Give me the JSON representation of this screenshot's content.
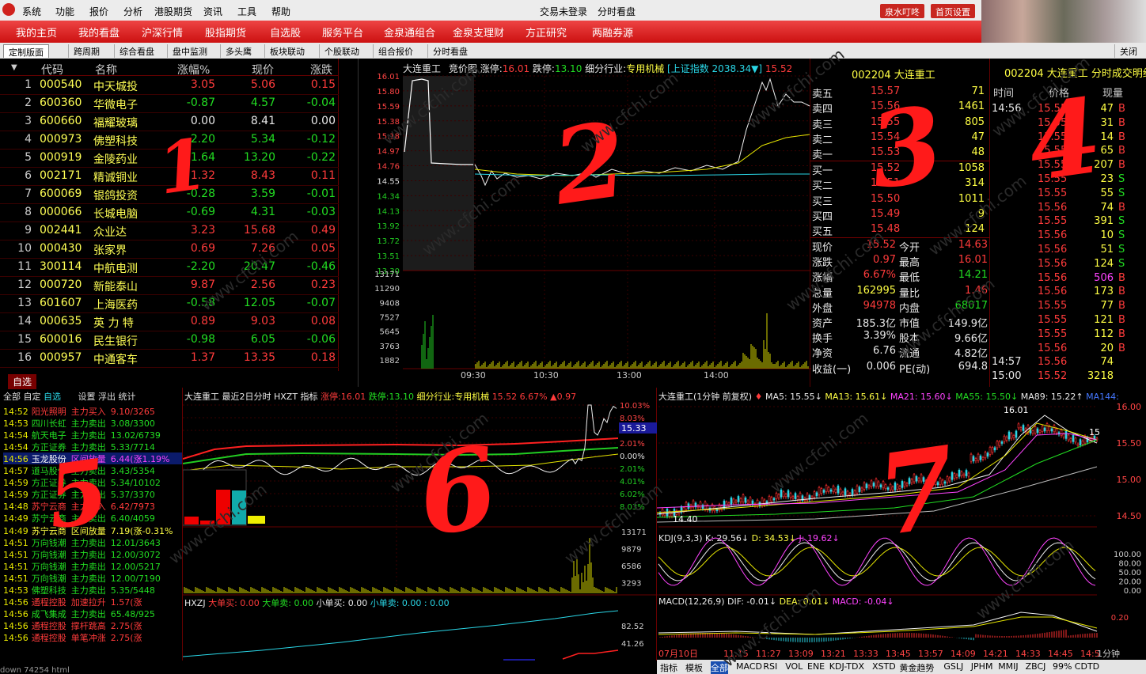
{
  "menu": {
    "items": [
      "系统",
      "功能",
      "报价",
      "分析",
      "港股期货",
      "资讯",
      "工具",
      "帮助"
    ],
    "center1": "交易未登录",
    "center2": "分时看盘",
    "btn1": "泉水叮咚",
    "btn2": "首页设置"
  },
  "nav": {
    "items": [
      "我的主页",
      "我的看盘",
      "沪深行情",
      "股指期货",
      "自选股",
      "服务平台",
      "金泉通组合",
      "金泉支理财",
      "方正研究",
      "两融券源"
    ]
  },
  "tabs": {
    "items": [
      "定制版面",
      "跨周期",
      "综合看盘",
      "盘中监测",
      "多头鹰",
      "板块联动",
      "个股联动",
      "组合报价",
      "分时看盘"
    ],
    "close": "关闭"
  },
  "list": {
    "headers": [
      "代码",
      "名称",
      "涨幅%",
      "现价",
      "涨跌"
    ],
    "rows": [
      {
        "i": "1",
        "code": "000540",
        "name": "中天城投",
        "pct": "3.05",
        "price": "5.06",
        "chg": "0.15",
        "c": "r"
      },
      {
        "i": "2",
        "code": "600360",
        "name": "华微电子",
        "pct": "-0.87",
        "price": "4.57",
        "chg": "-0.04",
        "c": "g"
      },
      {
        "i": "3",
        "code": "600660",
        "name": "福耀玻璃",
        "pct": "0.00",
        "price": "8.41",
        "chg": "0.00",
        "c": "w"
      },
      {
        "i": "4",
        "code": "000973",
        "name": "佛塑科技",
        "pct": "-2.20",
        "price": "5.34",
        "chg": "-0.12",
        "c": "g"
      },
      {
        "i": "5",
        "code": "000919",
        "name": "金陵药业",
        "pct": "-1.64",
        "price": "13.20",
        "chg": "-0.22",
        "c": "g"
      },
      {
        "i": "6",
        "code": "002171",
        "name": "精诚铜业",
        "pct": "1.32",
        "price": "8.43",
        "chg": "0.11",
        "c": "r"
      },
      {
        "i": "7",
        "code": "600069",
        "name": "银鸽投资",
        "pct": "-0.28",
        "price": "3.59",
        "chg": "-0.01",
        "c": "g"
      },
      {
        "i": "8",
        "code": "000066",
        "name": "长城电脑",
        "pct": "-0.69",
        "price": "4.31",
        "chg": "-0.03",
        "c": "g"
      },
      {
        "i": "9",
        "code": "002441",
        "name": "众业达",
        "pct": "3.23",
        "price": "15.68",
        "chg": "0.49",
        "c": "r"
      },
      {
        "i": "10",
        "code": "000430",
        "name": "张家界",
        "pct": "0.69",
        "price": "7.26",
        "chg": "0.05",
        "c": "r"
      },
      {
        "i": "11",
        "code": "300114",
        "name": "中航电测",
        "pct": "-2.20",
        "price": "20.47",
        "chg": "-0.46",
        "c": "g"
      },
      {
        "i": "12",
        "code": "000720",
        "name": "新能泰山",
        "pct": "9.87",
        "price": "2.56",
        "chg": "0.23",
        "c": "r"
      },
      {
        "i": "13",
        "code": "601607",
        "name": "上海医药",
        "pct": "-0.58",
        "price": "12.05",
        "chg": "-0.07",
        "c": "g"
      },
      {
        "i": "14",
        "code": "000635",
        "name": "英 力 特",
        "pct": "0.89",
        "price": "9.03",
        "chg": "0.08",
        "c": "r"
      },
      {
        "i": "15",
        "code": "600016",
        "name": "民生银行",
        "pct": "-0.98",
        "price": "6.05",
        "chg": "-0.06",
        "c": "g"
      },
      {
        "i": "16",
        "code": "000957",
        "name": "中通客车",
        "pct": "1.37",
        "price": "13.35",
        "chg": "0.18",
        "c": "r"
      }
    ],
    "zixuan": "自选"
  },
  "intraday": {
    "title": "大连重工",
    "sub": "竞价图",
    "zt_label": "涨停:",
    "zt": "16.01",
    "dt_label": "跌停:",
    "dt": "13.10",
    "ind_label": "细分行业:",
    "industry": "专用机械",
    "index": "[上证指数 2038.34▼]",
    "last": "15.52",
    "yticks": [
      "16.01",
      "15.80",
      "15.59",
      "15.38",
      "15.18",
      "14.97",
      "14.76",
      "14.55",
      "14.34",
      "14.13",
      "13.92",
      "13.72",
      "13.51",
      "13.30"
    ],
    "vticks": [
      "13171",
      "11290",
      "9408",
      "7527",
      "5645",
      "3763",
      "1882"
    ],
    "xticks": [
      "09:30",
      "10:30",
      "13:00",
      "14:00"
    ]
  },
  "quote": {
    "title": "002204 大连重工",
    "asks": [
      [
        "卖五",
        "15.57",
        "71"
      ],
      [
        "卖四",
        "15.56",
        "1461"
      ],
      [
        "卖三",
        "15.55",
        "805"
      ],
      [
        "卖二",
        "15.54",
        "47"
      ],
      [
        "卖一",
        "15.53",
        "48"
      ]
    ],
    "bids": [
      [
        "买一",
        "15.52",
        "1058"
      ],
      [
        "买二",
        "15.51",
        "314"
      ],
      [
        "买三",
        "15.50",
        "1011"
      ],
      [
        "买四",
        "15.49",
        "9"
      ],
      [
        "买五",
        "15.48",
        "124"
      ]
    ],
    "stats": [
      [
        "现价",
        "15.52",
        "今开",
        "14.63"
      ],
      [
        "涨跌",
        "0.97",
        "最高",
        "16.01"
      ],
      [
        "涨幅",
        "6.67%",
        "最低",
        "14.21"
      ],
      [
        "总量",
        "162995",
        "量比",
        "1.46"
      ],
      [
        "外盘",
        "94978",
        "内盘",
        "68017"
      ],
      [
        "资产",
        "185.3亿",
        "市值",
        "149.9亿"
      ],
      [
        "换手",
        "3.39%",
        "股本",
        "9.66亿"
      ],
      [
        "净资",
        "6.76",
        "流通",
        "4.82亿"
      ],
      [
        "收益(一)",
        "0.006",
        "PE(动)",
        "694.8"
      ]
    ]
  },
  "ticks": {
    "title": "002204 大连重工 分时成交明细",
    "headers": [
      "时间",
      "价格",
      "现量"
    ],
    "rows": [
      [
        "14:56",
        "15.55",
        "47",
        "B"
      ],
      [
        "",
        "15.55",
        "31",
        "B"
      ],
      [
        "",
        "15.55",
        "14",
        "B"
      ],
      [
        "",
        "15.55",
        "65",
        "B"
      ],
      [
        "",
        "15.55",
        "207",
        "B"
      ],
      [
        "",
        "15.55",
        "23",
        "S"
      ],
      [
        "",
        "15.55",
        "55",
        "S"
      ],
      [
        "",
        "15.56",
        "74",
        "B"
      ],
      [
        "",
        "15.55",
        "391",
        "S"
      ],
      [
        "",
        "15.56",
        "10",
        "S"
      ],
      [
        "",
        "15.56",
        "51",
        "S"
      ],
      [
        "",
        "15.56",
        "124",
        "S"
      ],
      [
        "",
        "15.56",
        "506",
        "B"
      ],
      [
        "",
        "15.56",
        "173",
        "B"
      ],
      [
        "",
        "15.55",
        "77",
        "B"
      ],
      [
        "",
        "15.55",
        "121",
        "B"
      ],
      [
        "",
        "15.55",
        "112",
        "B"
      ],
      [
        "",
        "15.56",
        "20",
        "B"
      ],
      [
        "14:57",
        "15.56",
        "74",
        ""
      ],
      [
        "15:00",
        "15.52",
        "3218",
        ""
      ]
    ]
  },
  "alerts": {
    "tabs": [
      "全部",
      "自定",
      "自选",
      "设置",
      "浮出",
      "统计"
    ],
    "rows": [
      [
        "14:52",
        "阳光照明",
        "主力买入",
        "9.10/3265",
        "r"
      ],
      [
        "14:53",
        "四川长虹",
        "主力卖出",
        "3.08/3300",
        "g"
      ],
      [
        "14:54",
        "航天电子",
        "主力卖出",
        "13.02/6739",
        "g"
      ],
      [
        "14:54",
        "方正证券",
        "主力卖出",
        "5.33/7714",
        "g"
      ],
      [
        "14:56",
        "玉龙股份",
        "区间放量",
        "6.44(涨1.19%",
        "sel"
      ],
      [
        "14:57",
        "道马股份",
        "主力卖出",
        "3.43/5354",
        "g"
      ],
      [
        "14:59",
        "方正证券",
        "主力卖出",
        "5.34/10102",
        "g"
      ],
      [
        "14:59",
        "方正证券",
        "主力卖出",
        "5.37/3370",
        "g"
      ],
      [
        "14:48",
        "苏宁云商",
        "主力买入",
        "6.42/7973",
        "r"
      ],
      [
        "14:49",
        "苏宁云商",
        "主力卖出",
        "6.40/4059",
        "g"
      ],
      [
        "14:49",
        "苏宁云商",
        "区间放量",
        "7.19(涨-0.31%",
        "y"
      ],
      [
        "14:51",
        "万向钱潮",
        "主力卖出",
        "12.01/3643",
        "g"
      ],
      [
        "14:51",
        "万向钱潮",
        "主力卖出",
        "12.00/3072",
        "g"
      ],
      [
        "14:51",
        "万向钱潮",
        "主力卖出",
        "12.00/5217",
        "g"
      ],
      [
        "14:51",
        "万向钱潮",
        "主力卖出",
        "12.00/7190",
        "g"
      ],
      [
        "14:53",
        "佛塑科技",
        "主力卖出",
        "5.35/5448",
        "g"
      ],
      [
        "14:56",
        "通程控股",
        "加速拉升",
        "1.57(涨",
        "r"
      ],
      [
        "14:56",
        "成飞集成",
        "主力卖出",
        "65.48/925",
        "g"
      ],
      [
        "14:56",
        "通程控股",
        "撑杆跳高",
        "2.75(涨",
        "r"
      ],
      [
        "14:56",
        "通程控股",
        "单笔冲涨",
        "2.75(涨",
        "r"
      ]
    ]
  },
  "twoday": {
    "title": "大连重工  最近2日分时 HXZT 指标",
    "zt": "涨停:16.01",
    "dt": "跌停:13.10",
    "ind": "细分行业:专用机械",
    "pxpct": "15.52 6.67% ▲0.97",
    "rticks": [
      "10.03%",
      "8.03%",
      "4.01%",
      "2.01%",
      "0.00%",
      "2.01%",
      "4.01%",
      "6.02%",
      "8.03%"
    ],
    "price": "15.33",
    "vticks": [
      "13171",
      "9879",
      "6586",
      "3293"
    ],
    "hxzt": "HXZJ",
    "dmb": "大单买: 0.00",
    "dms": "大单卖: 0.00",
    "xmb": "小单买: 0.00",
    "xms": "小单卖: 0.00 : 0.00",
    "hx_r": [
      "82.52",
      "41.26"
    ],
    "dates": [
      "07/10/四",
      "13:26"
    ]
  },
  "kline": {
    "title": "大连重工(1分钟 前复权)",
    "ma5": "MA5: 15.55↓",
    "ma13": "MA13: 15.61↓",
    "ma21": "MA21: 15.60↓",
    "ma55": "MA55: 15.50↓",
    "ma89": "MA89: 15.22↑",
    "ma144": "MA144:",
    "yticks": [
      "16.00",
      "15.50",
      "15.00",
      "14.50"
    ],
    "hi": "16.01",
    "lo": "14.40",
    "cur": "15",
    "kdj": "KDJ(9,3,3)",
    "k": "K: 29.56↓",
    "d": "D: 34.53↓",
    "j": "J: 19.62↓",
    "kticks": [
      "100.00",
      "80.00",
      "50.00",
      "20.00",
      "0.00"
    ],
    "macd": "MACD(12,26,9)",
    "dif": "DIF: -0.01↓",
    "dea": "DEA: 0.01↓",
    "macdv": "MACD: -0.04↓",
    "mticks": [
      "0.20"
    ],
    "xdate": "07月10日",
    "xticks": [
      "11:15",
      "11:27",
      "13:09",
      "13:21",
      "13:33",
      "13:45",
      "13:57",
      "14:09",
      "14:21",
      "14:33",
      "14:45",
      "14:5"
    ],
    "period": "1分钟",
    "bottom": [
      "指标",
      "模板",
      "全部",
      "MACD",
      "RSI",
      "VOL",
      "ENE",
      "KDJ-TDX",
      "XSTD",
      "黄金趋势",
      "GSLJ",
      "JPHM",
      "MMIJ",
      "ZBCJ",
      "99%",
      "CDTD"
    ]
  },
  "digits": [
    "1",
    "2",
    "3",
    "4",
    "5",
    "6",
    "7"
  ],
  "watermark": "www.cfchi.com",
  "status": "down 74254 html"
}
